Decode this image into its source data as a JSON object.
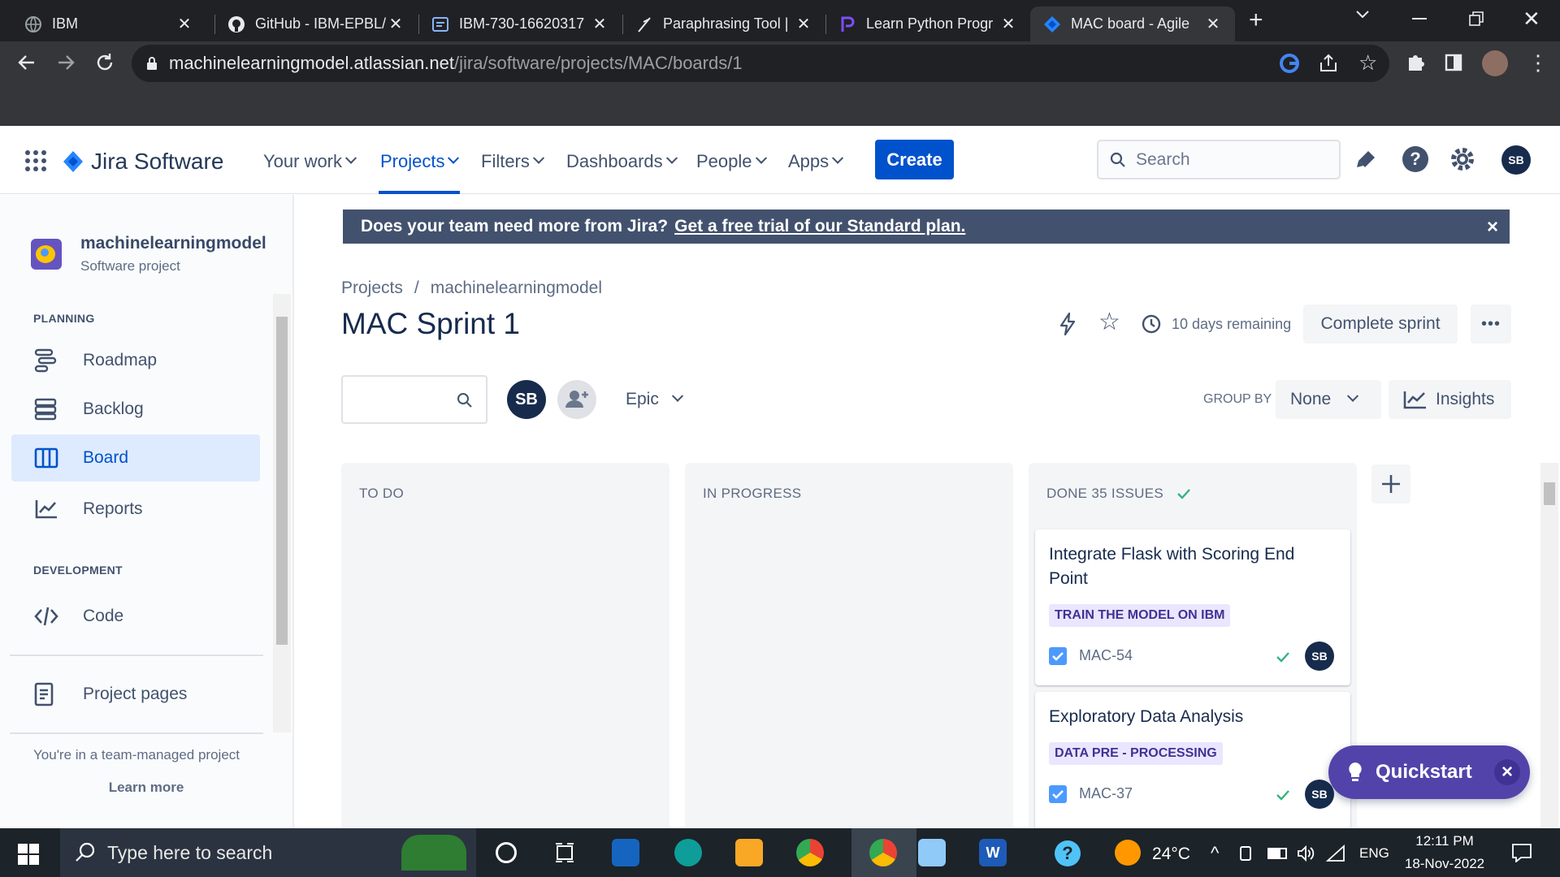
{
  "browser": {
    "tabs": [
      {
        "title": "IBM",
        "active": false
      },
      {
        "title": "GitHub - IBM-EPBL/",
        "active": false
      },
      {
        "title": "IBM-730-16620317",
        "active": false
      },
      {
        "title": "Paraphrasing Tool |",
        "active": false
      },
      {
        "title": "Learn Python Progr",
        "active": false
      },
      {
        "title": "MAC board - Agile",
        "active": true
      }
    ],
    "url_host": "machinelearningmodel.atlassian.net",
    "url_path": "/jira/software/projects/MAC/boards/1"
  },
  "topnav": {
    "product": "Jira Software",
    "items": [
      "Your work",
      "Projects",
      "Filters",
      "Dashboards",
      "People",
      "Apps"
    ],
    "active_item": "Projects",
    "create_label": "Create",
    "search_placeholder": "Search",
    "user_initials": "SB"
  },
  "sidebar": {
    "project_name": "machinelearningmodel",
    "project_type": "Software project",
    "planning_heading": "PLANNING",
    "planning_items": [
      "Roadmap",
      "Backlog",
      "Board",
      "Reports"
    ],
    "selected_item": "Board",
    "development_heading": "DEVELOPMENT",
    "development_items": [
      "Code"
    ],
    "project_pages": "Project pages",
    "footer_text": "You're in a team-managed project",
    "learn_more": "Learn more"
  },
  "banner": {
    "text": "Does your team need more from Jira?",
    "link": "Get a free trial of our Standard plan."
  },
  "header": {
    "breadcrumb_root": "Projects",
    "breadcrumb_sep": "/",
    "breadcrumb_project": "machinelearningmodel",
    "title": "MAC Sprint 1",
    "remaining": "10 days remaining",
    "complete_label": "Complete sprint",
    "more_label": "•••"
  },
  "filters": {
    "avatar_initials": "SB",
    "epic_label": "Epic",
    "group_by_label": "GROUP BY",
    "group_by_value": "None",
    "insights_label": "Insights"
  },
  "board": {
    "columns": [
      {
        "title": "TO DO"
      },
      {
        "title": "IN PROGRESS"
      },
      {
        "title": "DONE 35 ISSUES"
      }
    ],
    "done_cards": [
      {
        "summary_line1": "Integrate Flask with Scoring End",
        "summary_line2": "Point",
        "epic": "TRAIN THE MODEL ON IBM",
        "key": "MAC-54",
        "assignee": "SB"
      },
      {
        "summary_line1": "Exploratory Data Analysis",
        "epic": "DATA PRE - PROCESSING",
        "key": "MAC-37",
        "assignee": "SB"
      }
    ]
  },
  "quickstart": {
    "label": "Quickstart",
    "close": "×"
  },
  "taskbar": {
    "search_placeholder": "Type here to search",
    "weather": "24°C",
    "language": "ENG",
    "time": "12:11 PM",
    "date": "18-Nov-2022"
  },
  "colors": {
    "brand_blue": "#0052cc",
    "epic_bg": "#eae6ff",
    "epic_text": "#403294",
    "banner_bg": "#42526e",
    "done_green": "#36b37e"
  }
}
